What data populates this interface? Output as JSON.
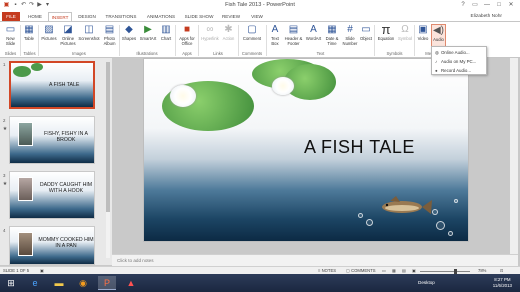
{
  "titlebar": {
    "title": "Fish Tale 2013 - PowerPoint",
    "controls": {
      "help": "?",
      "restore": "▭",
      "minimize": "—",
      "maximize": "□",
      "close": "✕"
    }
  },
  "tabs": [
    "FILE",
    "HOME",
    "INSERT",
    "DESIGN",
    "TRANSITIONS",
    "ANIMATIONS",
    "SLIDE SHOW",
    "REVIEW",
    "VIEW"
  ],
  "active_tab": "INSERT",
  "user_name": "Elizabeth Nohr",
  "ribbon": {
    "new_slide": "New Slide",
    "table": "Table",
    "pictures": "Pictures",
    "online_pictures": "Online Pictures",
    "screenshot": "Screenshot",
    "photo_album": "Photo Album",
    "shapes": "Shapes",
    "smartart": "SmartArt",
    "chart": "Chart",
    "apps_for_office": "Apps for Office",
    "hyperlink": "Hyperlink",
    "action": "Action",
    "comment": "Comment",
    "text_box": "Text Box",
    "header_footer": "Header & Footer",
    "wordart": "WordArt",
    "date_time": "Date & Time",
    "slide_number": "Slide Number",
    "object": "Object",
    "equation": "Equation",
    "symbol": "Symbol",
    "video": "Video",
    "audio": "Audio",
    "groups": {
      "slides": "Slides",
      "tables": "Tables",
      "images": "Images",
      "illustrations": "Illustrations",
      "apps": "Apps",
      "links": "Links",
      "comments": "Comments",
      "text": "Text",
      "symbols": "Symbols",
      "media": "Media"
    }
  },
  "audio_menu": [
    "Online Audio...",
    "Audio on My PC...",
    "Record Audio..."
  ],
  "slides": [
    {
      "number": "1",
      "title": "A FISH TALE"
    },
    {
      "number": "2",
      "title": "FISHY, FISHY IN A BROOK"
    },
    {
      "number": "3",
      "title": "DADDY CAUGHT HIM WITH A HOOK"
    },
    {
      "number": "4",
      "title": "MOMMY COOKED HIM IN A PAN"
    }
  ],
  "main_slide": {
    "title": "A FISH TALE"
  },
  "notes_placeholder": "Click to add notes",
  "status": {
    "slide_info": "SLIDE 1 OF 5",
    "notes": "NOTES",
    "comments": "COMMENTS",
    "zoom": "78%"
  },
  "taskbar": {
    "desktop": "Desktop",
    "time": "8:27 PM",
    "date": "11/6/2013"
  }
}
